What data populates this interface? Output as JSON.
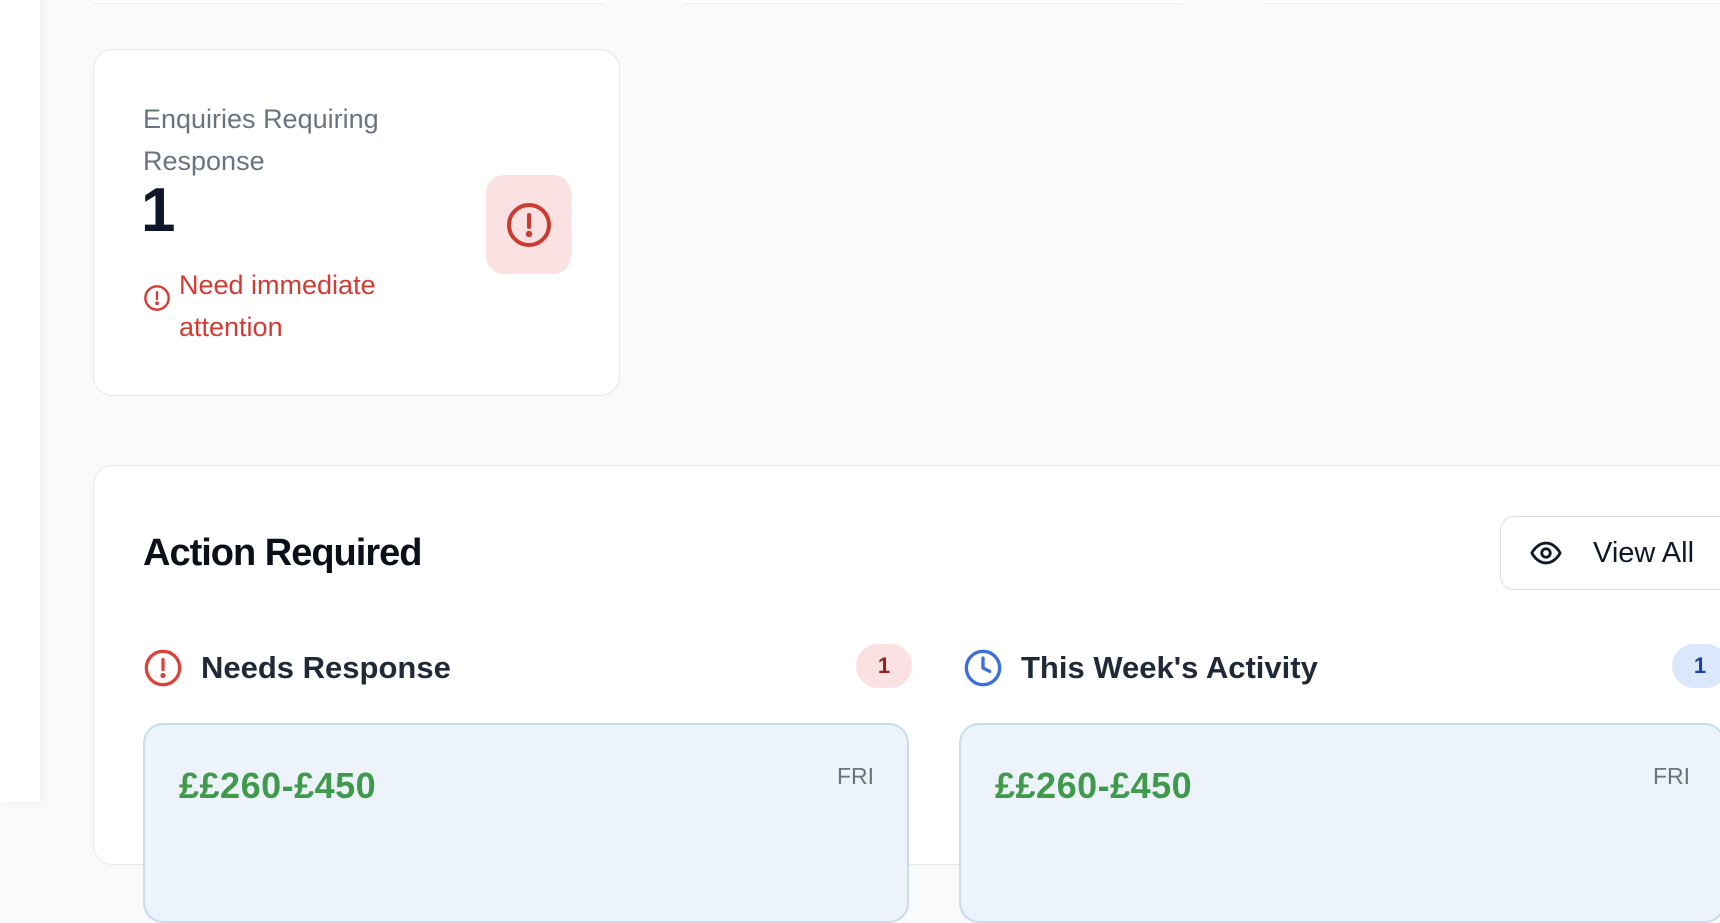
{
  "stat_card": {
    "label": "Enquiries Requiring Response",
    "value": "1",
    "note": "Need immediate attention",
    "icon": "alert-circle-icon",
    "accent_color": "#d33b33"
  },
  "action_panel": {
    "title": "Action Required",
    "view_all_label": "View All",
    "view_all_icon": "eye-icon",
    "columns": [
      {
        "title": "Needs Response",
        "icon": "alert-circle-icon",
        "count": "1",
        "card": {
          "price": "££260-£450",
          "day": "FRI"
        }
      },
      {
        "title": "This Week's Activity",
        "icon": "clock-icon",
        "count": "1",
        "card": {
          "price": "££260-£450",
          "day": "FRI"
        }
      }
    ]
  },
  "colors": {
    "alert_red": "#d33b33",
    "info_blue": "#3b6fe0",
    "price_green": "#3f9a4b"
  }
}
